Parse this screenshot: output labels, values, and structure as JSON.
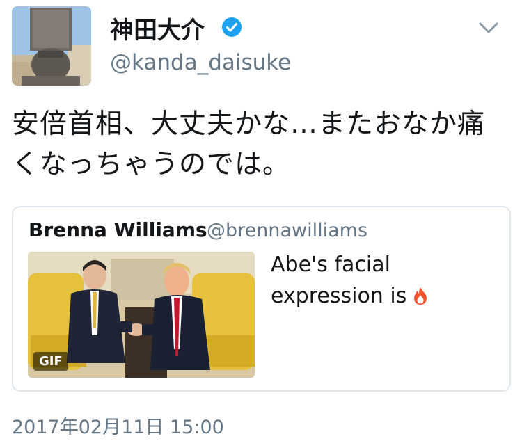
{
  "author": {
    "display_name": "神田大介",
    "handle": "@kanda_daisuke",
    "verified": true,
    "avatar_icon": "statue-avatar-icon"
  },
  "tweet": {
    "text_line1": "安倍首相、大丈夫かな…またおなか痛",
    "text_line2": "くなっちゃうのでは。",
    "timestamp": "2017年02月11日 15:00"
  },
  "quoted_tweet": {
    "display_name": "Brenna Williams",
    "handle": "@brennawilliams",
    "text_line1": "Abe's facial",
    "text_line2": "expression is",
    "emoji_icon": "fire-icon",
    "media_badge": "GIF"
  },
  "colors": {
    "text": "#14171a",
    "secondary": "#657786",
    "verified": "#1da1f2",
    "border": "#e1e8ed"
  }
}
